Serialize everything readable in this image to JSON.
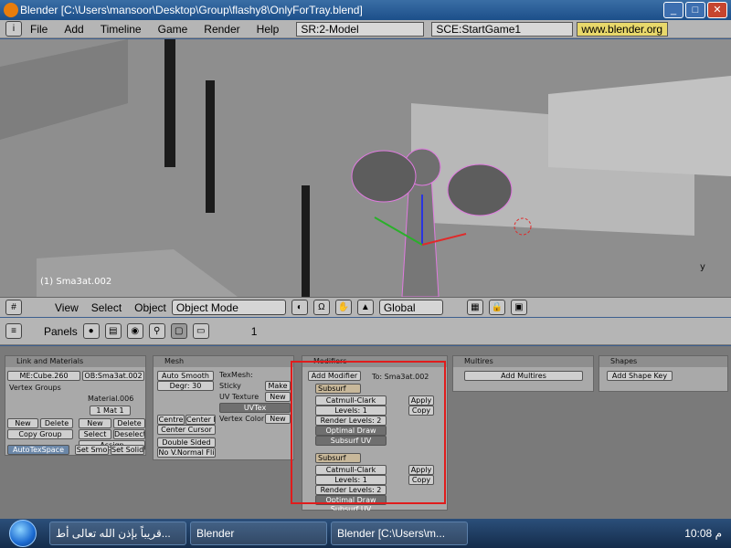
{
  "window": {
    "title": "Blender [C:\\Users\\mansoor\\Desktop\\Group\\flashy8\\OnlyForTray.blend]"
  },
  "menu": {
    "items": [
      "File",
      "Add",
      "Timeline",
      "Game",
      "Render",
      "Help"
    ],
    "screen": "SR:2-Model",
    "scene": "SCE:StartGame1",
    "url": "www.blender.org"
  },
  "viewport": {
    "object_label": "(1) Sma3at.002",
    "axis_y": "y"
  },
  "viewport_toolbar": {
    "view": "View",
    "select": "Select",
    "object": "Object",
    "mode": "Object Mode",
    "orientation": "Global"
  },
  "buttons_header": {
    "panels": "Panels",
    "frame": "1"
  },
  "link_materials": {
    "title": "Link and Materials",
    "me": "ME:Cube.260",
    "ob": "OB:Sma3at.002",
    "vertex_groups": "Vertex Groups",
    "material": "Material.006",
    "mat_index": "1 Mat 1",
    "new": "New",
    "delete": "Delete",
    "copy_group": "Copy Group",
    "new2": "New",
    "delete2": "Delete",
    "select": "Select",
    "deselect": "Deselect",
    "assign": "Assign",
    "autotexspace": "AutoTexSpace",
    "set_smo": "Set Smo",
    "set_solid": "Set Solid"
  },
  "mesh": {
    "title": "Mesh",
    "auto_smooth": "Auto Smooth",
    "degr": "Degr: 30",
    "texmesh": "TexMesh:",
    "sticky": "Sticky",
    "make": "Make",
    "uv_texture": "UV Texture",
    "new": "New",
    "uvtex": "UVTex",
    "vertex_color": "Vertex Color",
    "new2": "New",
    "centre": "Centre",
    "center_new": "Center Ne",
    "center_cursor": "Center Cursor",
    "double_sided": "Double Sided",
    "no_vnormal": "No V.Normal Fli"
  },
  "modifiers": {
    "title": "Modifiers",
    "add": "Add Modifier",
    "to": "To: Sma3at.002",
    "items": [
      {
        "name": "Subsurf",
        "type": "Catmull-Clark",
        "levels": "Levels: 1",
        "render_levels": "Render Levels: 2",
        "optimal": "Optimal Draw",
        "subsurf_uv": "Subsurf UV",
        "apply": "Apply",
        "copy": "Copy"
      },
      {
        "name": "Subsurf",
        "type": "Catmull-Clark",
        "levels": "Levels: 1",
        "render_levels": "Render Levels: 2",
        "optimal": "Optimal Draw",
        "subsurf_uv": "Subsurf UV",
        "apply": "Apply",
        "copy": "Copy"
      }
    ]
  },
  "multires": {
    "title": "Multires",
    "add": "Add Multires"
  },
  "shapes": {
    "title": "Shapes",
    "add": "Add Shape Key"
  },
  "taskbar": {
    "item1": "قريباً بإذن الله تعالى أط...",
    "item2": "Blender",
    "item3": "Blender [C:\\Users\\m...",
    "clock": "10:08 م"
  }
}
